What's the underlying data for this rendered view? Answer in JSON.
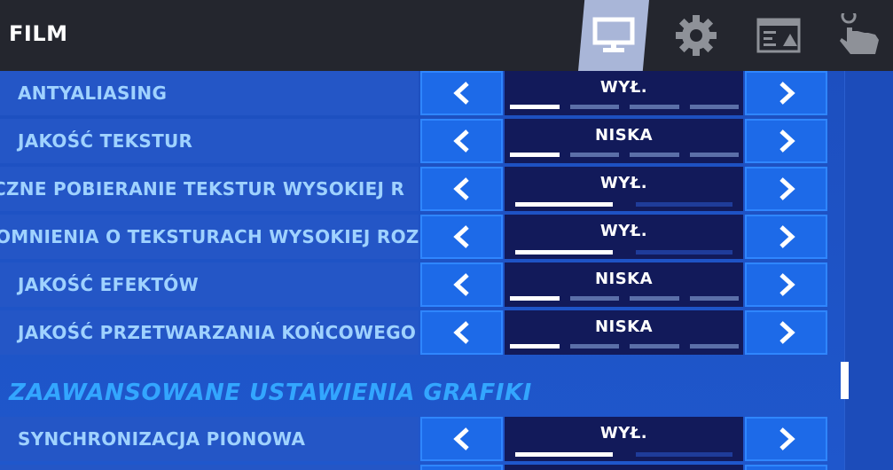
{
  "header": {
    "title": "FILM",
    "tabs": [
      {
        "icon": "monitor-icon",
        "active": true
      },
      {
        "icon": "gear-icon",
        "active": false
      },
      {
        "icon": "hud-layout-icon",
        "active": false
      },
      {
        "icon": "touch-icon",
        "active": false
      }
    ]
  },
  "settings": [
    {
      "label": "ANTYALIASING",
      "value": "WYŁ.",
      "kind": "segments",
      "level": 1,
      "levels": 4
    },
    {
      "label": "JAKOŚĆ TEKSTUR",
      "value": "NISKA",
      "kind": "segments",
      "level": 1,
      "levels": 4
    },
    {
      "label": "CZNE POBIERANIE TEKSTUR WYSOKIEJ R",
      "value": "WYŁ.",
      "kind": "toggle",
      "level": 1,
      "levels": 2
    },
    {
      "label": "OMNIENIA O TEKSTURACH WYSOKIEJ ROZ",
      "value": "WYŁ.",
      "kind": "toggle",
      "level": 1,
      "levels": 2
    },
    {
      "label": "JAKOŚĆ EFEKTÓW",
      "value": "NISKA",
      "kind": "segments",
      "level": 1,
      "levels": 4
    },
    {
      "label": "JAKOŚĆ PRZETWARZANIA KOŃCOWEGO",
      "value": "NISKA",
      "kind": "segments",
      "level": 1,
      "levels": 4
    }
  ],
  "advanced_section": {
    "title": "ZAAWANSOWANE USTAWIENIA GRAFIKI",
    "settings": [
      {
        "label": "SYNCHRONIZACJA PIONOWA",
        "value": "WYŁ.",
        "kind": "toggle",
        "level": 1,
        "levels": 2
      }
    ]
  },
  "colors": {
    "accent": "#1d6ae8",
    "label_text": "#9fd2ff",
    "section_header": "#33a6ff",
    "value_bg": "#121a5a"
  }
}
